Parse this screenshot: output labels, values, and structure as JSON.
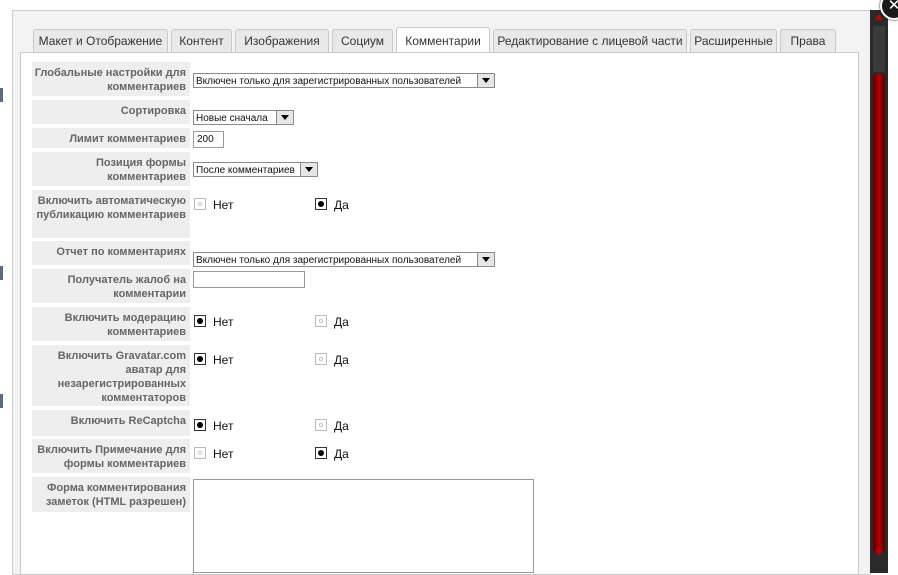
{
  "tabs": [
    {
      "label": "Макет и Отображение"
    },
    {
      "label": "Контент"
    },
    {
      "label": "Изображения"
    },
    {
      "label": "Социум"
    },
    {
      "label": "Комментарии"
    },
    {
      "label": "Редактирование с лицевой части"
    },
    {
      "label": "Расширенные"
    },
    {
      "label": "Права"
    }
  ],
  "active_tab": "Комментарии",
  "form": {
    "global_settings": {
      "label": "Глобальные настройки для комментариев",
      "value": "Включен только для зарегистрированных пользователей"
    },
    "sorting": {
      "label": "Сортировка",
      "value": "Новые сначала"
    },
    "limit": {
      "label": "Лимит комментариев",
      "value": "200"
    },
    "form_position": {
      "label": "Позиция формы комментариев",
      "value": "После комментариев"
    },
    "auto_publish": {
      "label": "Включить автоматическую публикацию комментариев",
      "no": "Нет",
      "yes": "Да",
      "selected": "Да"
    },
    "report": {
      "label": "Отчет по комментариях",
      "value": "Включен только для зарегистрированных пользователей"
    },
    "complaints_recipient": {
      "label": "Получатель жалоб на комментарии",
      "value": ""
    },
    "moderation": {
      "label": "Включить модерацию комментариев",
      "no": "Нет",
      "yes": "Да",
      "selected": "Нет"
    },
    "gravatar": {
      "label": "Включить Gravatar.com аватар для незарегистрированных комментаторов",
      "no": "Нет",
      "yes": "Да",
      "selected": "Нет"
    },
    "recaptcha": {
      "label": "Включить ReCaptcha",
      "no": "Нет",
      "yes": "Да",
      "selected": "Нет"
    },
    "note": {
      "label": "Включить Примечание для формы комментариев",
      "no": "Нет",
      "yes": "Да",
      "selected": "Да"
    },
    "notes_form": {
      "label": "Форма комментирования заметок (HTML разрешен)",
      "value": ""
    }
  },
  "colors": {
    "scroll_thumb": "#b00000",
    "label_bg": "#eeeeee"
  },
  "icons": {
    "close": "close-icon",
    "dropdown": "chevron-down-icon"
  }
}
